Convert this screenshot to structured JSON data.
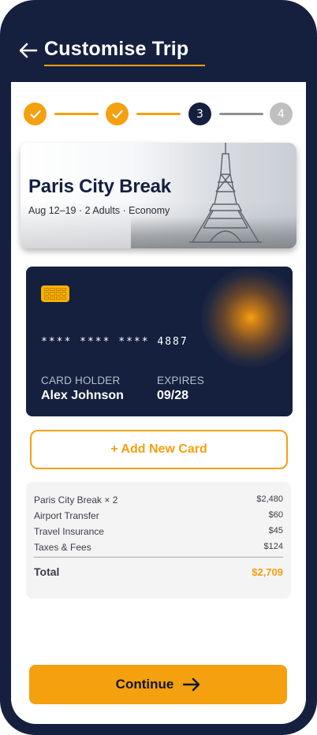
{
  "header": {
    "title": "Customise Trip",
    "back_icon": "arrow-left-icon"
  },
  "stepper": {
    "steps": [
      {
        "label": "",
        "state": "done",
        "icon": "check-icon"
      },
      {
        "label": "",
        "state": "done",
        "icon": "check-icon"
      },
      {
        "label": "3",
        "state": "current"
      },
      {
        "label": "4",
        "state": "upcoming"
      }
    ]
  },
  "trip": {
    "title": "Paris City Break",
    "subtitle": "Aug 12–19 · 2 Adults · Economy"
  },
  "card": {
    "number": "**** **** **** 4887",
    "holder_label": "CARD HOLDER",
    "holder_name": "Alex Johnson",
    "expires_label": "EXPIRES",
    "expires_value": "09/28"
  },
  "add_card_label": "+ Add New Card",
  "summary": {
    "items": [
      {
        "label": "Paris City Break × 2",
        "value": "$2,480"
      },
      {
        "label": "Airport Transfer",
        "value": "$60"
      },
      {
        "label": "Travel Insurance",
        "value": "$45"
      },
      {
        "label": "Taxes & Fees",
        "value": "$124"
      }
    ],
    "total_label": "Total",
    "total_value": "$2,709"
  },
  "continue_label": "Continue",
  "colors": {
    "navy": "#15203f",
    "accent": "#f5a00f",
    "muted": "#bfbfbf"
  }
}
